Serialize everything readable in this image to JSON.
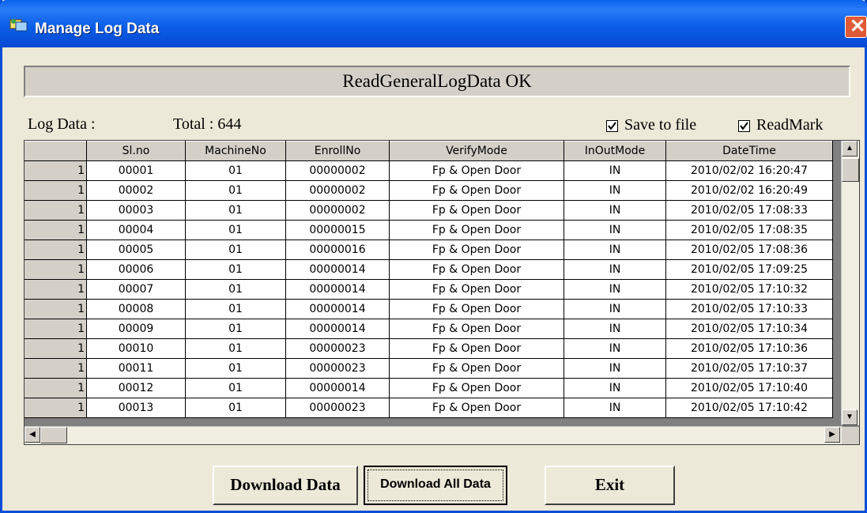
{
  "window": {
    "title": "Manage Log Data"
  },
  "status": {
    "message": "ReadGeneralLogData OK"
  },
  "summary": {
    "log_label": "Log Data :",
    "total_label": "Total : 644"
  },
  "options": {
    "save_to_file": "Save to file",
    "read_mark": "ReadMark",
    "save_checked": true,
    "read_checked": true
  },
  "table": {
    "columns": [
      "",
      "Sl.no",
      "MachineNo",
      "EnrollNo",
      "VerifyMode",
      "InOutMode",
      "DateTime"
    ],
    "rows": [
      [
        "1",
        "00001",
        "01",
        "00000002",
        "Fp & Open Door",
        "IN",
        "2010/02/02 16:20:47"
      ],
      [
        "1",
        "00002",
        "01",
        "00000002",
        "Fp & Open Door",
        "IN",
        "2010/02/02 16:20:49"
      ],
      [
        "1",
        "00003",
        "01",
        "00000002",
        "Fp & Open Door",
        "IN",
        "2010/02/05 17:08:33"
      ],
      [
        "1",
        "00004",
        "01",
        "00000015",
        "Fp & Open Door",
        "IN",
        "2010/02/05 17:08:35"
      ],
      [
        "1",
        "00005",
        "01",
        "00000016",
        "Fp & Open Door",
        "IN",
        "2010/02/05 17:08:36"
      ],
      [
        "1",
        "00006",
        "01",
        "00000014",
        "Fp & Open Door",
        "IN",
        "2010/02/05 17:09:25"
      ],
      [
        "1",
        "00007",
        "01",
        "00000014",
        "Fp & Open Door",
        "IN",
        "2010/02/05 17:10:32"
      ],
      [
        "1",
        "00008",
        "01",
        "00000014",
        "Fp & Open Door",
        "IN",
        "2010/02/05 17:10:33"
      ],
      [
        "1",
        "00009",
        "01",
        "00000014",
        "Fp & Open Door",
        "IN",
        "2010/02/05 17:10:34"
      ],
      [
        "1",
        "00010",
        "01",
        "00000023",
        "Fp & Open Door",
        "IN",
        "2010/02/05 17:10:36"
      ],
      [
        "1",
        "00011",
        "01",
        "00000023",
        "Fp & Open Door",
        "IN",
        "2010/02/05 17:10:37"
      ],
      [
        "1",
        "00012",
        "01",
        "00000014",
        "Fp & Open Door",
        "IN",
        "2010/02/05 17:10:40"
      ],
      [
        "1",
        "00013",
        "01",
        "00000023",
        "Fp & Open Door",
        "IN",
        "2010/02/05 17:10:42"
      ]
    ]
  },
  "buttons": {
    "download": "Download Data",
    "download_all": "Download All Data",
    "exit": "Exit"
  },
  "icons": {
    "title": "app-icon",
    "close": "close-icon",
    "scroll_up": "arrow-up-icon",
    "scroll_down": "arrow-down-icon",
    "scroll_left": "arrow-left-icon",
    "scroll_right": "arrow-right-icon"
  },
  "colors": {
    "titlebar": "#0a62f0",
    "close": "#e05a35",
    "face": "#ece9d8"
  }
}
